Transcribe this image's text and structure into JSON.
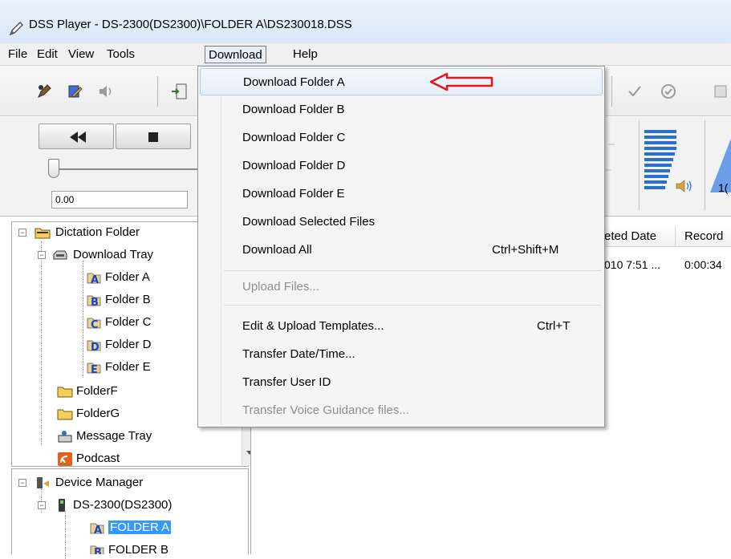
{
  "window": {
    "title": "DSS Player - DS-2300(DS2300)\\FOLDER A\\DS230018.DSS"
  },
  "menubar": {
    "items": [
      "File",
      "Edit",
      "View",
      "Tools",
      "Download",
      "Help"
    ],
    "active": "Download"
  },
  "transport": {
    "time": "0.00"
  },
  "volume": {
    "readout": "1("
  },
  "dictation_tree": {
    "root": "Dictation Folder",
    "download_tray": "Download Tray",
    "folders": [
      "Folder A",
      "Folder B",
      "Folder C",
      "Folder D",
      "Folder E"
    ],
    "folder_letters": [
      "A",
      "B",
      "C",
      "D",
      "E"
    ],
    "extra": [
      "FolderF",
      "FolderG",
      "Message Tray",
      "Podcast"
    ]
  },
  "device_tree": {
    "root": "Device Manager",
    "device": "DS-2300(DS2300)",
    "folders": [
      "FOLDER A",
      "FOLDER B"
    ],
    "selected": "FOLDER A"
  },
  "file_list": {
    "columns": [
      "eted Date",
      "Record"
    ],
    "rows": [
      {
        "date": "010 7:51 ...",
        "length": "0:00:34"
      }
    ]
  },
  "download_menu": {
    "items": [
      {
        "label": "Download Folder A",
        "shortcut": ""
      },
      {
        "label": "Download Folder B",
        "shortcut": ""
      },
      {
        "label": "Download Folder C",
        "shortcut": ""
      },
      {
        "label": "Download Folder D",
        "shortcut": ""
      },
      {
        "label": "Download Folder E",
        "shortcut": ""
      },
      {
        "label": "Download Selected Files",
        "shortcut": ""
      },
      {
        "label": "Download All",
        "shortcut": "Ctrl+Shift+M"
      },
      {
        "label": "Upload Files...",
        "shortcut": ""
      },
      {
        "label": "Edit & Upload Templates...",
        "shortcut": "Ctrl+T"
      },
      {
        "label": "Transfer Date/Time...",
        "shortcut": ""
      },
      {
        "label": "Transfer User ID",
        "shortcut": ""
      },
      {
        "label": "Transfer Voice Guidance files...",
        "shortcut": ""
      }
    ],
    "highlighted": "Download Folder A",
    "disabled": [
      "Upload Files...",
      "Transfer Voice Guidance files..."
    ]
  },
  "colors": {
    "selection": "#3399ff",
    "annotation_arrow": "#e8141b",
    "folder_letter": "#1f3fd1"
  }
}
